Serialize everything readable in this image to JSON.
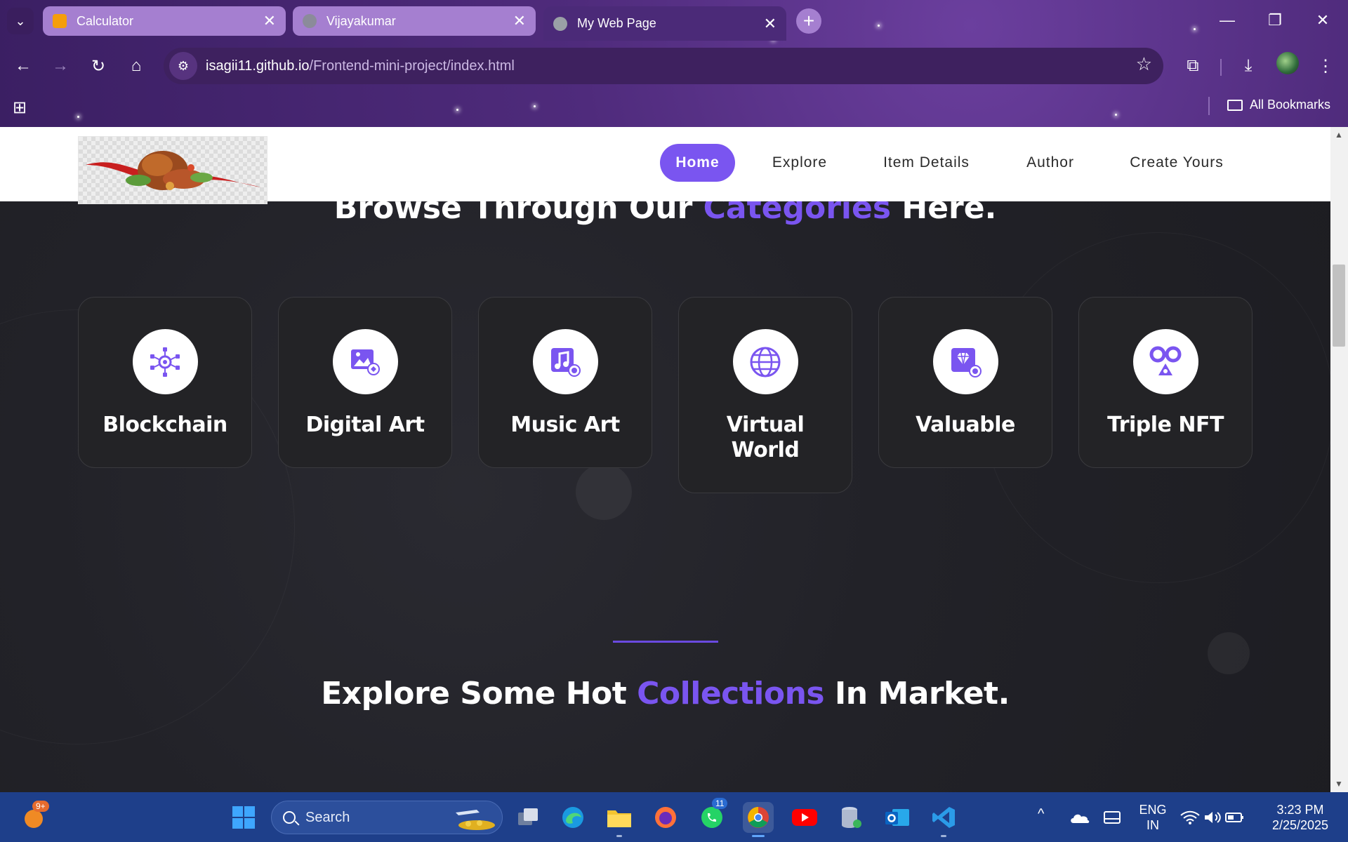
{
  "browser": {
    "tabs": [
      {
        "title": "Calculator",
        "close": "✕",
        "favicon_color": "#f59e0b"
      },
      {
        "title": "Vijayakumar",
        "close": "✕",
        "favicon_color": "#8b8b9a"
      },
      {
        "title": "My Web Page",
        "close": "✕",
        "favicon_color": "#9aa0a6"
      }
    ],
    "new_tab": "+",
    "window_controls": {
      "minimize": "—",
      "restore": "❐",
      "close": "✕"
    },
    "url_host": "isagii11.github.io",
    "url_path": "/Frontend-mini-project/index.html",
    "bookmarks_label": "All Bookmarks"
  },
  "site": {
    "nav": [
      {
        "label": "Home",
        "active": true
      },
      {
        "label": "Explore",
        "active": false
      },
      {
        "label": "Item Details",
        "active": false
      },
      {
        "label": "Author",
        "active": false
      },
      {
        "label": "Create Yours",
        "active": false
      }
    ],
    "browse_heading": {
      "pre": "Browse Through Our ",
      "accent": "Categories",
      "post": " Here."
    },
    "categories": [
      {
        "label": "Blockchain",
        "icon": "blockchain-icon"
      },
      {
        "label": "Digital Art",
        "icon": "digital-art-icon"
      },
      {
        "label": "Music Art",
        "icon": "music-art-icon"
      },
      {
        "label": "Virtual World",
        "icon": "globe-icon"
      },
      {
        "label": "Valuable",
        "icon": "diamond-icon"
      },
      {
        "label": "Triple NFT",
        "icon": "triple-nft-icon"
      }
    ],
    "collections_heading": {
      "pre": "Explore Some Hot ",
      "accent": "Collections",
      "post": " In Market."
    },
    "accent_color": "#7a55f0"
  },
  "taskbar": {
    "search_placeholder": "Search",
    "notification_badge": "9+",
    "whatsapp_badge": "11",
    "language": "ENG",
    "region": "IN",
    "time": "3:23 PM",
    "date": "2/25/2025"
  }
}
